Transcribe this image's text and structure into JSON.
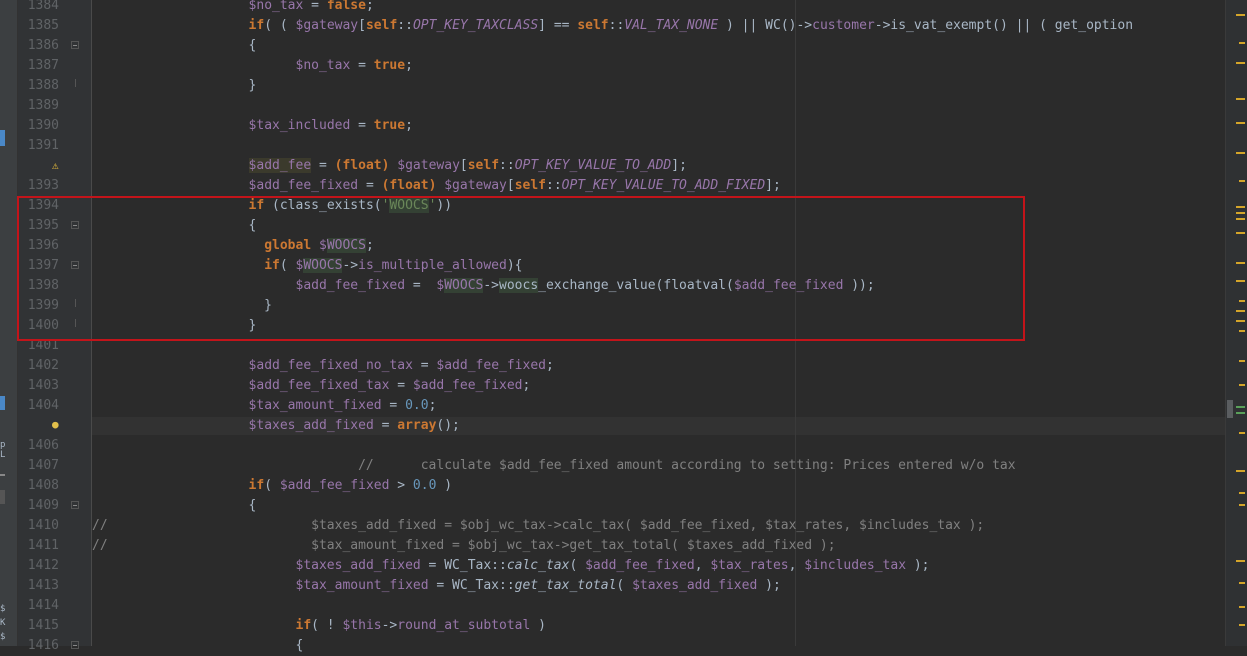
{
  "editor": {
    "lines": [
      {
        "num": "1384",
        "tokens": [
          {
            "t": "                    ",
            "c": ""
          },
          {
            "t": "$no_tax",
            "c": "var"
          },
          {
            "t": " = ",
            "c": ""
          },
          {
            "t": "false",
            "c": "kw"
          },
          {
            "t": ";",
            "c": ""
          }
        ]
      },
      {
        "num": "1385",
        "tokens": [
          {
            "t": "                    ",
            "c": ""
          },
          {
            "t": "if",
            "c": "kw"
          },
          {
            "t": "( ( ",
            "c": ""
          },
          {
            "t": "$gateway",
            "c": "var"
          },
          {
            "t": "[",
            "c": ""
          },
          {
            "t": "self",
            "c": "kw"
          },
          {
            "t": "::",
            "c": ""
          },
          {
            "t": "OPT_KEY_TAXCLASS",
            "c": "const"
          },
          {
            "t": "] == ",
            "c": ""
          },
          {
            "t": "self",
            "c": "kw"
          },
          {
            "t": "::",
            "c": ""
          },
          {
            "t": "VAL_TAX_NONE",
            "c": "const"
          },
          {
            "t": " ) || WC()->",
            "c": ""
          },
          {
            "t": "customer",
            "c": "var"
          },
          {
            "t": "->is_vat_exempt() || ( get_option",
            "c": ""
          }
        ]
      },
      {
        "num": "1386",
        "fold": "start",
        "tokens": [
          {
            "t": "                    {",
            "c": ""
          }
        ]
      },
      {
        "num": "1387",
        "tokens": [
          {
            "t": "                          ",
            "c": ""
          },
          {
            "t": "$no_tax",
            "c": "var"
          },
          {
            "t": " = ",
            "c": ""
          },
          {
            "t": "true",
            "c": "kw"
          },
          {
            "t": ";",
            "c": ""
          }
        ]
      },
      {
        "num": "1388",
        "fold": "end",
        "tokens": [
          {
            "t": "                    }",
            "c": ""
          }
        ]
      },
      {
        "num": "1389",
        "tokens": []
      },
      {
        "num": "1390",
        "tokens": [
          {
            "t": "                    ",
            "c": ""
          },
          {
            "t": "$tax_included",
            "c": "var"
          },
          {
            "t": " = ",
            "c": ""
          },
          {
            "t": "true",
            "c": "kw"
          },
          {
            "t": ";",
            "c": ""
          }
        ]
      },
      {
        "num": "1391",
        "tokens": []
      },
      {
        "num": "",
        "warn": true,
        "tokens": [
          {
            "t": "                    ",
            "c": ""
          },
          {
            "t": "$add_fee",
            "c": "var addfee-hl"
          },
          {
            "t": " = ",
            "c": ""
          },
          {
            "t": "(float)",
            "c": "kw"
          },
          {
            "t": " ",
            "c": ""
          },
          {
            "t": "$gateway",
            "c": "var"
          },
          {
            "t": "[",
            "c": ""
          },
          {
            "t": "self",
            "c": "kw"
          },
          {
            "t": "::",
            "c": ""
          },
          {
            "t": "OPT_KEY_VALUE_TO_ADD",
            "c": "const"
          },
          {
            "t": "];",
            "c": ""
          }
        ]
      },
      {
        "num": "1393",
        "tokens": [
          {
            "t": "                    ",
            "c": ""
          },
          {
            "t": "$add_fee_fixed",
            "c": "var"
          },
          {
            "t": " = ",
            "c": ""
          },
          {
            "t": "(float)",
            "c": "kw"
          },
          {
            "t": " ",
            "c": ""
          },
          {
            "t": "$gateway",
            "c": "var"
          },
          {
            "t": "[",
            "c": ""
          },
          {
            "t": "self",
            "c": "kw"
          },
          {
            "t": "::",
            "c": ""
          },
          {
            "t": "OPT_KEY_VALUE_TO_ADD_FIXED",
            "c": "const"
          },
          {
            "t": "];",
            "c": ""
          }
        ]
      },
      {
        "num": "1394",
        "tokens": [
          {
            "t": "                    ",
            "c": ""
          },
          {
            "t": "if",
            "c": "kw"
          },
          {
            "t": " (class_exists(",
            "c": ""
          },
          {
            "t": "'",
            "c": "str"
          },
          {
            "t": "WOOCS",
            "c": "str hl"
          },
          {
            "t": "'",
            "c": "str"
          },
          {
            "t": "))",
            "c": ""
          }
        ]
      },
      {
        "num": "1395",
        "fold": "start",
        "tokens": [
          {
            "t": "                    {",
            "c": ""
          }
        ]
      },
      {
        "num": "1396",
        "tokens": [
          {
            "t": "                      ",
            "c": ""
          },
          {
            "t": "global",
            "c": "kw"
          },
          {
            "t": " ",
            "c": ""
          },
          {
            "t": "$",
            "c": "var"
          },
          {
            "t": "WOOCS",
            "c": "var hl"
          },
          {
            "t": ";",
            "c": ""
          }
        ]
      },
      {
        "num": "1397",
        "fold": "start",
        "tokens": [
          {
            "t": "                      ",
            "c": ""
          },
          {
            "t": "if",
            "c": "kw"
          },
          {
            "t": "( ",
            "c": ""
          },
          {
            "t": "$",
            "c": "var"
          },
          {
            "t": "WOOCS",
            "c": "var hl"
          },
          {
            "t": "->",
            "c": ""
          },
          {
            "t": "is_multiple_allowed",
            "c": "var"
          },
          {
            "t": "){",
            "c": ""
          }
        ]
      },
      {
        "num": "1398",
        "tokens": [
          {
            "t": "                          ",
            "c": ""
          },
          {
            "t": "$add_fee_fixed",
            "c": "var"
          },
          {
            "t": " =  ",
            "c": ""
          },
          {
            "t": "$",
            "c": "var"
          },
          {
            "t": "WOOCS",
            "c": "var hl"
          },
          {
            "t": "->",
            "c": ""
          },
          {
            "t": "woocs",
            "c": "hl"
          },
          {
            "t": "_exchange_value(floatval(",
            "c": ""
          },
          {
            "t": "$add_fee_fixed",
            "c": "var"
          },
          {
            "t": " ));",
            "c": ""
          }
        ]
      },
      {
        "num": "1399",
        "fold": "end",
        "tokens": [
          {
            "t": "                      }",
            "c": ""
          }
        ]
      },
      {
        "num": "1400",
        "fold": "end",
        "tokens": [
          {
            "t": "                    }",
            "c": ""
          }
        ]
      },
      {
        "num": "1401",
        "tokens": []
      },
      {
        "num": "1402",
        "tokens": [
          {
            "t": "                    ",
            "c": ""
          },
          {
            "t": "$add_fee_fixed_no_tax",
            "c": "var"
          },
          {
            "t": " = ",
            "c": ""
          },
          {
            "t": "$add_fee_fixed",
            "c": "var"
          },
          {
            "t": ";",
            "c": ""
          }
        ]
      },
      {
        "num": "1403",
        "tokens": [
          {
            "t": "                    ",
            "c": ""
          },
          {
            "t": "$add_fee_fixed_tax",
            "c": "var"
          },
          {
            "t": " = ",
            "c": ""
          },
          {
            "t": "$add_fee_fixed",
            "c": "var"
          },
          {
            "t": ";",
            "c": ""
          }
        ]
      },
      {
        "num": "1404",
        "tokens": [
          {
            "t": "                    ",
            "c": ""
          },
          {
            "t": "$tax_amount_fixed",
            "c": "var"
          },
          {
            "t": " = ",
            "c": ""
          },
          {
            "t": "0.0",
            "c": "num"
          },
          {
            "t": ";",
            "c": ""
          }
        ]
      },
      {
        "num": "",
        "bulb": true,
        "tokens": [
          {
            "t": "                    ",
            "c": ""
          },
          {
            "t": "$taxes_add_fixed",
            "c": "var"
          },
          {
            "t": " = ",
            "c": ""
          },
          {
            "t": "array",
            "c": "kw"
          },
          {
            "t": "();",
            "c": ""
          }
        ]
      },
      {
        "num": "1406",
        "tokens": []
      },
      {
        "num": "1407",
        "tokens": [
          {
            "t": "                                  ",
            "c": ""
          },
          {
            "t": "//      calculate $add_fee_fixed amount according to setting: Prices entered w/o tax",
            "c": "cmt"
          }
        ]
      },
      {
        "num": "1408",
        "tokens": [
          {
            "t": "                    ",
            "c": ""
          },
          {
            "t": "if",
            "c": "kw"
          },
          {
            "t": "( ",
            "c": ""
          },
          {
            "t": "$add_fee_fixed",
            "c": "var"
          },
          {
            "t": " > ",
            "c": ""
          },
          {
            "t": "0.0",
            "c": "num"
          },
          {
            "t": " )",
            "c": ""
          }
        ]
      },
      {
        "num": "1409",
        "fold": "start",
        "tokens": [
          {
            "t": "                    {",
            "c": ""
          }
        ]
      },
      {
        "num": "1410",
        "tokens": [
          {
            "t": "//                          $taxes_add_fixed = $obj_wc_tax->calc_tax( $add_fee_fixed, $tax_rates, $includes_tax );",
            "c": "cmt"
          }
        ]
      },
      {
        "num": "1411",
        "tokens": [
          {
            "t": "//                          $tax_amount_fixed = $obj_wc_tax->get_tax_total( $taxes_add_fixed );",
            "c": "cmt"
          }
        ]
      },
      {
        "num": "1412",
        "tokens": [
          {
            "t": "                          ",
            "c": ""
          },
          {
            "t": "$taxes_add_fixed",
            "c": "var"
          },
          {
            "t": " = WC_Tax::",
            "c": ""
          },
          {
            "t": "calc_tax",
            "c": "ital"
          },
          {
            "t": "( ",
            "c": ""
          },
          {
            "t": "$add_fee_fixed",
            "c": "var"
          },
          {
            "t": ", ",
            "c": ""
          },
          {
            "t": "$tax_rates",
            "c": "var"
          },
          {
            "t": ", ",
            "c": ""
          },
          {
            "t": "$includes_tax",
            "c": "var"
          },
          {
            "t": " );",
            "c": ""
          }
        ]
      },
      {
        "num": "1413",
        "tokens": [
          {
            "t": "                          ",
            "c": ""
          },
          {
            "t": "$tax_amount_fixed",
            "c": "var"
          },
          {
            "t": " = WC_Tax::",
            "c": ""
          },
          {
            "t": "get_tax_total",
            "c": "ital"
          },
          {
            "t": "( ",
            "c": ""
          },
          {
            "t": "$taxes_add_fixed",
            "c": "var"
          },
          {
            "t": " );",
            "c": ""
          }
        ]
      },
      {
        "num": "1414",
        "tokens": []
      },
      {
        "num": "1415",
        "tokens": [
          {
            "t": "                          ",
            "c": ""
          },
          {
            "t": "if",
            "c": "kw"
          },
          {
            "t": "( ! ",
            "c": ""
          },
          {
            "t": "$this",
            "c": "var"
          },
          {
            "t": "->",
            "c": ""
          },
          {
            "t": "round_at_subtotal",
            "c": "var"
          },
          {
            "t": " )",
            "c": ""
          }
        ]
      },
      {
        "num": "1416",
        "fold": "start",
        "tokens": [
          {
            "t": "                          {",
            "c": ""
          }
        ]
      }
    ]
  },
  "left_strip": {
    "glyphs": [
      "p",
      "L",
      "$",
      "K",
      "$"
    ]
  },
  "colors": {
    "keyword": "#cc7832",
    "variable": "#9876aa",
    "string": "#6a8759",
    "number": "#6897bb",
    "comment": "#808080",
    "highlight_box": "#c3141a"
  }
}
